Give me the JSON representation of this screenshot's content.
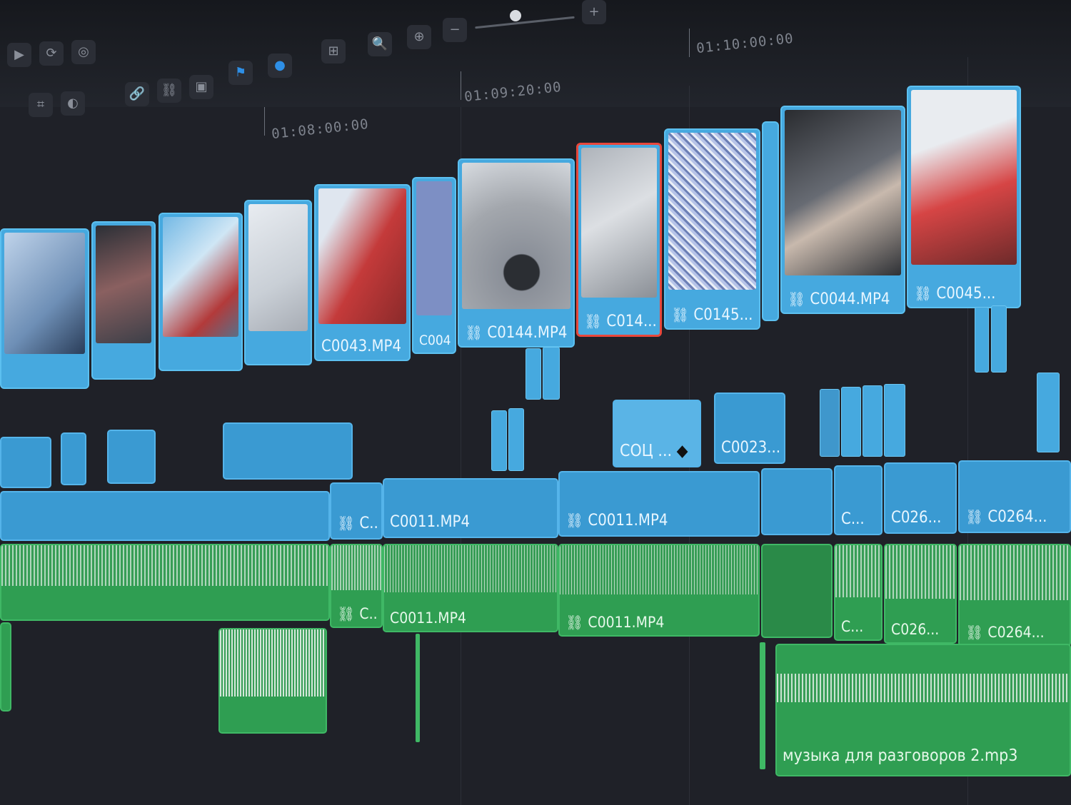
{
  "timeline": {
    "timecodes": [
      "01:08:00:00",
      "01:09:20:00",
      "01:10:00:00"
    ],
    "video_track_2": [
      {
        "label": "",
        "selected": false
      },
      {
        "label": "C0043.MP4",
        "selected": false
      },
      {
        "label": "C004...",
        "selected": false
      },
      {
        "label": "C0144.MP4",
        "selected": false
      },
      {
        "label": "C014...",
        "selected": true
      },
      {
        "label": "C0145...",
        "selected": false
      },
      {
        "label": "C0044.MP4",
        "selected": false
      },
      {
        "label": "C0045...",
        "selected": false
      }
    ],
    "video_track_1b": [
      {
        "label": "СОЦ ..."
      },
      {
        "label": "C0023...."
      }
    ],
    "video_track_1": [
      {
        "label": "C..."
      },
      {
        "label": "C0011.MP4"
      },
      {
        "label": "C0011.MP4"
      },
      {
        "label": "C..."
      },
      {
        "label": "C026..."
      },
      {
        "label": "C0264..."
      }
    ],
    "audio_track_1": [
      {
        "label": "C..."
      },
      {
        "label": "C0011.MP4"
      },
      {
        "label": "C0011.MP4"
      },
      {
        "label": "C..."
      },
      {
        "label": "C026..."
      },
      {
        "label": "C0264..."
      }
    ],
    "audio_track_2": [
      {
        "label": "музыка для разговоров 2.mp3"
      }
    ]
  },
  "colors": {
    "video_clip": "#46a9df",
    "audio_clip": "#2f9e52",
    "selected_outline": "#e8473b",
    "background": "#1f2128"
  },
  "icons": [
    "zoom-in-icon",
    "zoom-fit-icon",
    "zoom-out-icon",
    "link-icon",
    "flag-icon",
    "marker-icon",
    "minus-icon",
    "plus-icon"
  ]
}
